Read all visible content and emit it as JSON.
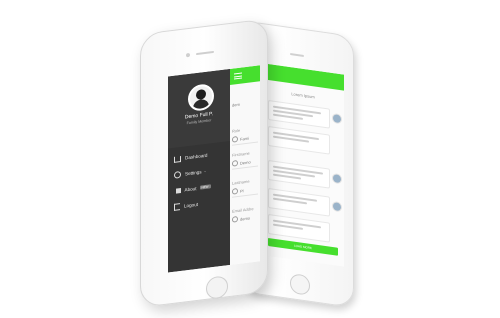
{
  "colors": {
    "accent": "#46df2e",
    "drawer": "#343434",
    "background": "#ffffff"
  },
  "back_phone": {
    "title": "Lorem Ipsum",
    "bottom_button": "LOAD MORE"
  },
  "front_phone": {
    "user": {
      "name": "Demo Full P.",
      "role": "Family Member"
    },
    "menu": [
      {
        "label": "Dashboard",
        "icon": "home-icon"
      },
      {
        "label": "Settings",
        "icon": "gear-icon"
      },
      {
        "label": "About",
        "icon": "info-icon",
        "badge": "NEW"
      },
      {
        "label": "Logout",
        "icon": "logout-icon"
      }
    ],
    "strip": {
      "top_text": "dem",
      "fields": [
        {
          "label": "Role",
          "value": "Fami"
        },
        {
          "label": "Firstname",
          "value": "Demo"
        },
        {
          "label": "Lastname",
          "value": "Pl"
        },
        {
          "label": "Email Addre",
          "value": "demo"
        }
      ]
    }
  }
}
